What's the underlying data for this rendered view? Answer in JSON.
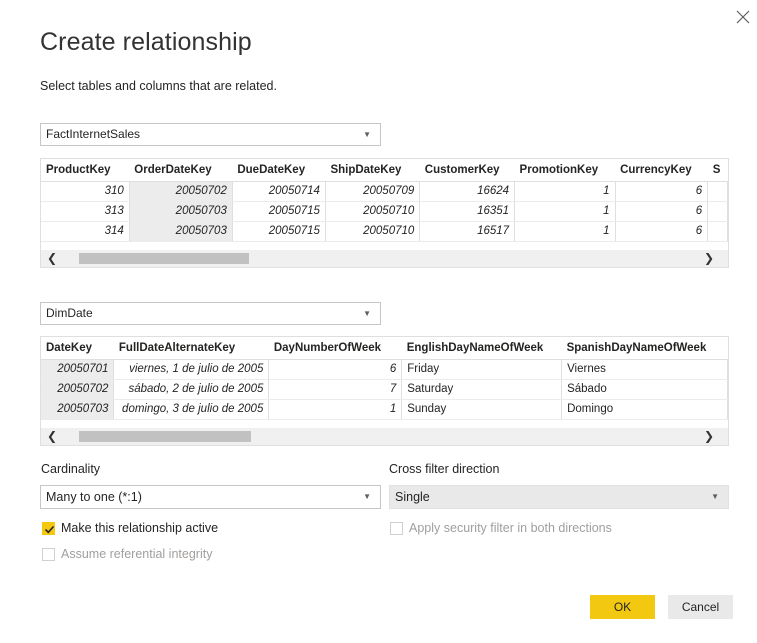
{
  "dialog": {
    "title": "Create relationship",
    "subtitle": "Select tables and columns that are related.",
    "close_icon": "close-icon"
  },
  "table1": {
    "name": "FactInternetSales",
    "columns": [
      "ProductKey",
      "OrderDateKey",
      "DueDateKey",
      "ShipDateKey",
      "CustomerKey",
      "PromotionKey",
      "CurrencyKey",
      "S"
    ],
    "rows": [
      [
        "310",
        "20050702",
        "20050714",
        "20050709",
        "16624",
        "1",
        "6",
        ""
      ],
      [
        "313",
        "20050703",
        "20050715",
        "20050710",
        "16351",
        "1",
        "6",
        ""
      ],
      [
        "314",
        "20050703",
        "20050715",
        "20050710",
        "16517",
        "1",
        "6",
        ""
      ]
    ],
    "selected_column": "OrderDateKey"
  },
  "table2": {
    "name": "DimDate",
    "columns": [
      "DateKey",
      "FullDateAlternateKey",
      "DayNumberOfWeek",
      "EnglishDayNameOfWeek",
      "SpanishDayNameOfWeek"
    ],
    "rows": [
      [
        "20050701",
        "viernes, 1 de julio de 2005",
        "6",
        "Friday",
        "Viernes"
      ],
      [
        "20050702",
        "sábado, 2 de julio de 2005",
        "7",
        "Saturday",
        "Sábado"
      ],
      [
        "20050703",
        "domingo, 3 de julio de 2005",
        "1",
        "Sunday",
        "Domingo"
      ]
    ],
    "selected_column": "DateKey"
  },
  "cardinality": {
    "label": "Cardinality",
    "value": "Many to one (*:1)"
  },
  "cross_filter": {
    "label": "Cross filter direction",
    "value": "Single"
  },
  "options": {
    "make_active": "Make this relationship active",
    "make_active_checked": true,
    "security_filter": "Apply security filter in both directions",
    "referential_integrity": "Assume referential integrity"
  },
  "buttons": {
    "ok": "OK",
    "cancel": "Cancel"
  },
  "colors": {
    "accent": "#f2c811",
    "selected_column_bg": "#ececec"
  }
}
